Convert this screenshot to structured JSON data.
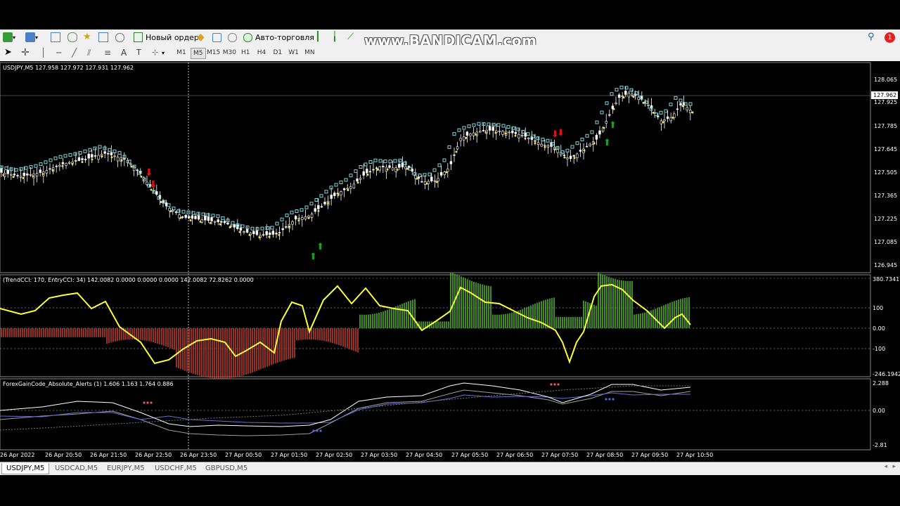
{
  "watermark": "www.BANDICAM.com",
  "toolbar": {
    "new_order_label": "Новый ордер",
    "autotrade_label": "Авто-торговля",
    "timeframes": [
      "M1",
      "M5",
      "M15",
      "M30",
      "H1",
      "H4",
      "D1",
      "W1",
      "MN"
    ],
    "notification_count": "1"
  },
  "main_chart": {
    "header": "USDJPY,M5  127.958 127.972 127.931 127.962",
    "price_labels": [
      "128.065",
      "127.925",
      "127.785",
      "127.645",
      "127.505",
      "127.365",
      "127.225",
      "127.085",
      "126.945"
    ],
    "current_price": "127.962"
  },
  "indicator1": {
    "header": "(TrendCCI: 170, EntryCCI: 34)  142.0082 0.0000 0.0000 0.0000 142.0082 72.8262 0.0000",
    "labels": [
      "380.7341",
      "100",
      "0.00",
      "-100",
      "-246.1942"
    ]
  },
  "indicator2": {
    "header": "ForexGainCode_Absolute_Alerts (1) 1.606 1.163 1.764 0.886",
    "labels": [
      "2.288",
      "0.00",
      "-2.81"
    ]
  },
  "time_labels": [
    "26 Apr 2022",
    "26 Apr 20:50",
    "26 Apr 21:50",
    "26 Apr 22:50",
    "26 Apr 23:50",
    "27 Apr 00:50",
    "27 Apr 01:50",
    "27 Apr 02:50",
    "27 Apr 03:50",
    "27 Apr 04:50",
    "27 Apr 05:50",
    "27 Apr 06:50",
    "27 Apr 07:50",
    "27 Apr 08:50",
    "27 Apr 09:50",
    "27 Apr 10:50"
  ],
  "tabs": [
    "USDJPY,M5",
    "USDCAD,M5",
    "EURJPY,M5",
    "USDCHF,M5",
    "GBPUSD,M5"
  ],
  "colors": {
    "candle": "#ffffff",
    "stepline": "#7fd3d8",
    "dots": "#f5e050",
    "trend_cci": "#ffff33",
    "hist_up": "#4caf2a",
    "hist_down": "#c0392b",
    "buy_arrow": "#1e9e28",
    "sell_arrow": "#e01010"
  }
}
